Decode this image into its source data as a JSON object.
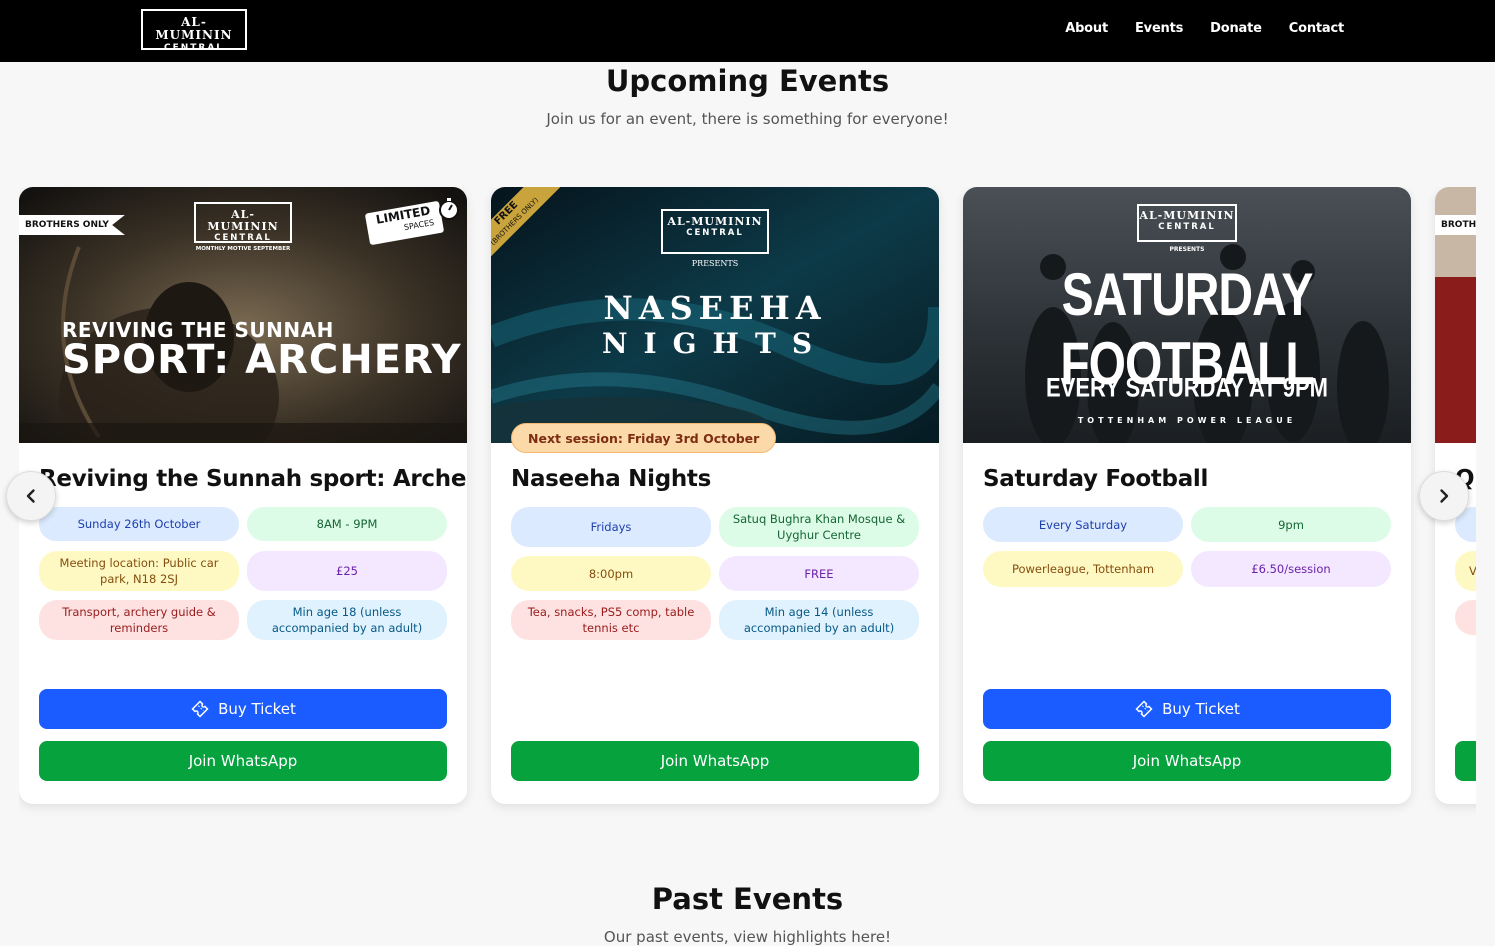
{
  "nav": {
    "logo_line1": "AL-MUMININ",
    "logo_line2": "CENTRAL",
    "links": [
      "About",
      "Events",
      "Donate",
      "Contact"
    ]
  },
  "upcoming": {
    "title": "Upcoming Events",
    "subtitle": "Join us for an event, there is something for everyone!"
  },
  "past": {
    "title": "Past Events",
    "subtitle": "Our past events, view highlights here!"
  },
  "cards": [
    {
      "title": "Reviving the Sunnah sport: Archery",
      "image": {
        "ribbon": "BROTHERS ONLY",
        "badge_line1": "LIMITED",
        "badge_line2": "SPACES",
        "logo_line1": "AL-MUMININ",
        "logo_line2": "CENTRAL",
        "logo_caption": "MONTHLY MOTIVE SEPTEMBER",
        "headline1": "REVIVING THE SUNNAH",
        "headline2": "SPORT: ARCHERY"
      },
      "chips": [
        "Sunday 26th October",
        "8AM - 9PM",
        "Meeting location: Public car park, N18 2SJ",
        "£25",
        "Transport, archery guide & reminders",
        "Min age 18 (unless accompanied by an adult)"
      ],
      "buy_label": "Buy Ticket",
      "whatsapp_label": "Join WhatsApp"
    },
    {
      "title": "Naseeha Nights",
      "image": {
        "corner_line1": "FREE",
        "corner_line2": "(BROTHERS ONLY)",
        "logo_line1": "AL-MUMININ",
        "logo_line2": "CENTRAL",
        "logo_caption": "PRESENTS",
        "headline1": "NASEEHA",
        "headline2": "NIGHTS",
        "session_badge": "Next session: Friday 3rd October"
      },
      "chips": [
        "Fridays",
        "Satuq Bughra Khan Mosque & Uyghur Centre",
        "8:00pm",
        "FREE",
        "Tea, snacks, PS5 comp, table tennis etc",
        "Min age 14 (unless accompanied by an adult)"
      ],
      "whatsapp_label": "Join WhatsApp"
    },
    {
      "title": "Saturday Football",
      "image": {
        "logo_line1": "AL-MUMININ",
        "logo_line2": "CENTRAL",
        "logo_caption": "PRESENTS",
        "headline1": "SATURDAY FOOTBALL",
        "headline2": "EVERY SATURDAY AT 9PM",
        "headline3": "TOTTENHAM POWER LEAGUE"
      },
      "chips": [
        "Every Saturday",
        "9pm",
        "Powerleague, Tottenham",
        "£6.50/session"
      ],
      "buy_label": "Buy Ticket",
      "whatsapp_label": "Join WhatsApp"
    },
    {
      "title": "Qu",
      "image": {
        "ribbon": "BROTHE"
      },
      "chips": [
        "",
        "V",
        ""
      ]
    }
  ],
  "icons": {
    "prev": "chevron-left-icon",
    "next": "chevron-right-icon",
    "ticket": "ticket-icon",
    "stopwatch": "stopwatch-icon"
  },
  "colors": {
    "navbar": "#000000",
    "buy_button": "#1a5cff",
    "whatsapp_button": "#05a23e",
    "session_badge": "#fcd9a8"
  }
}
